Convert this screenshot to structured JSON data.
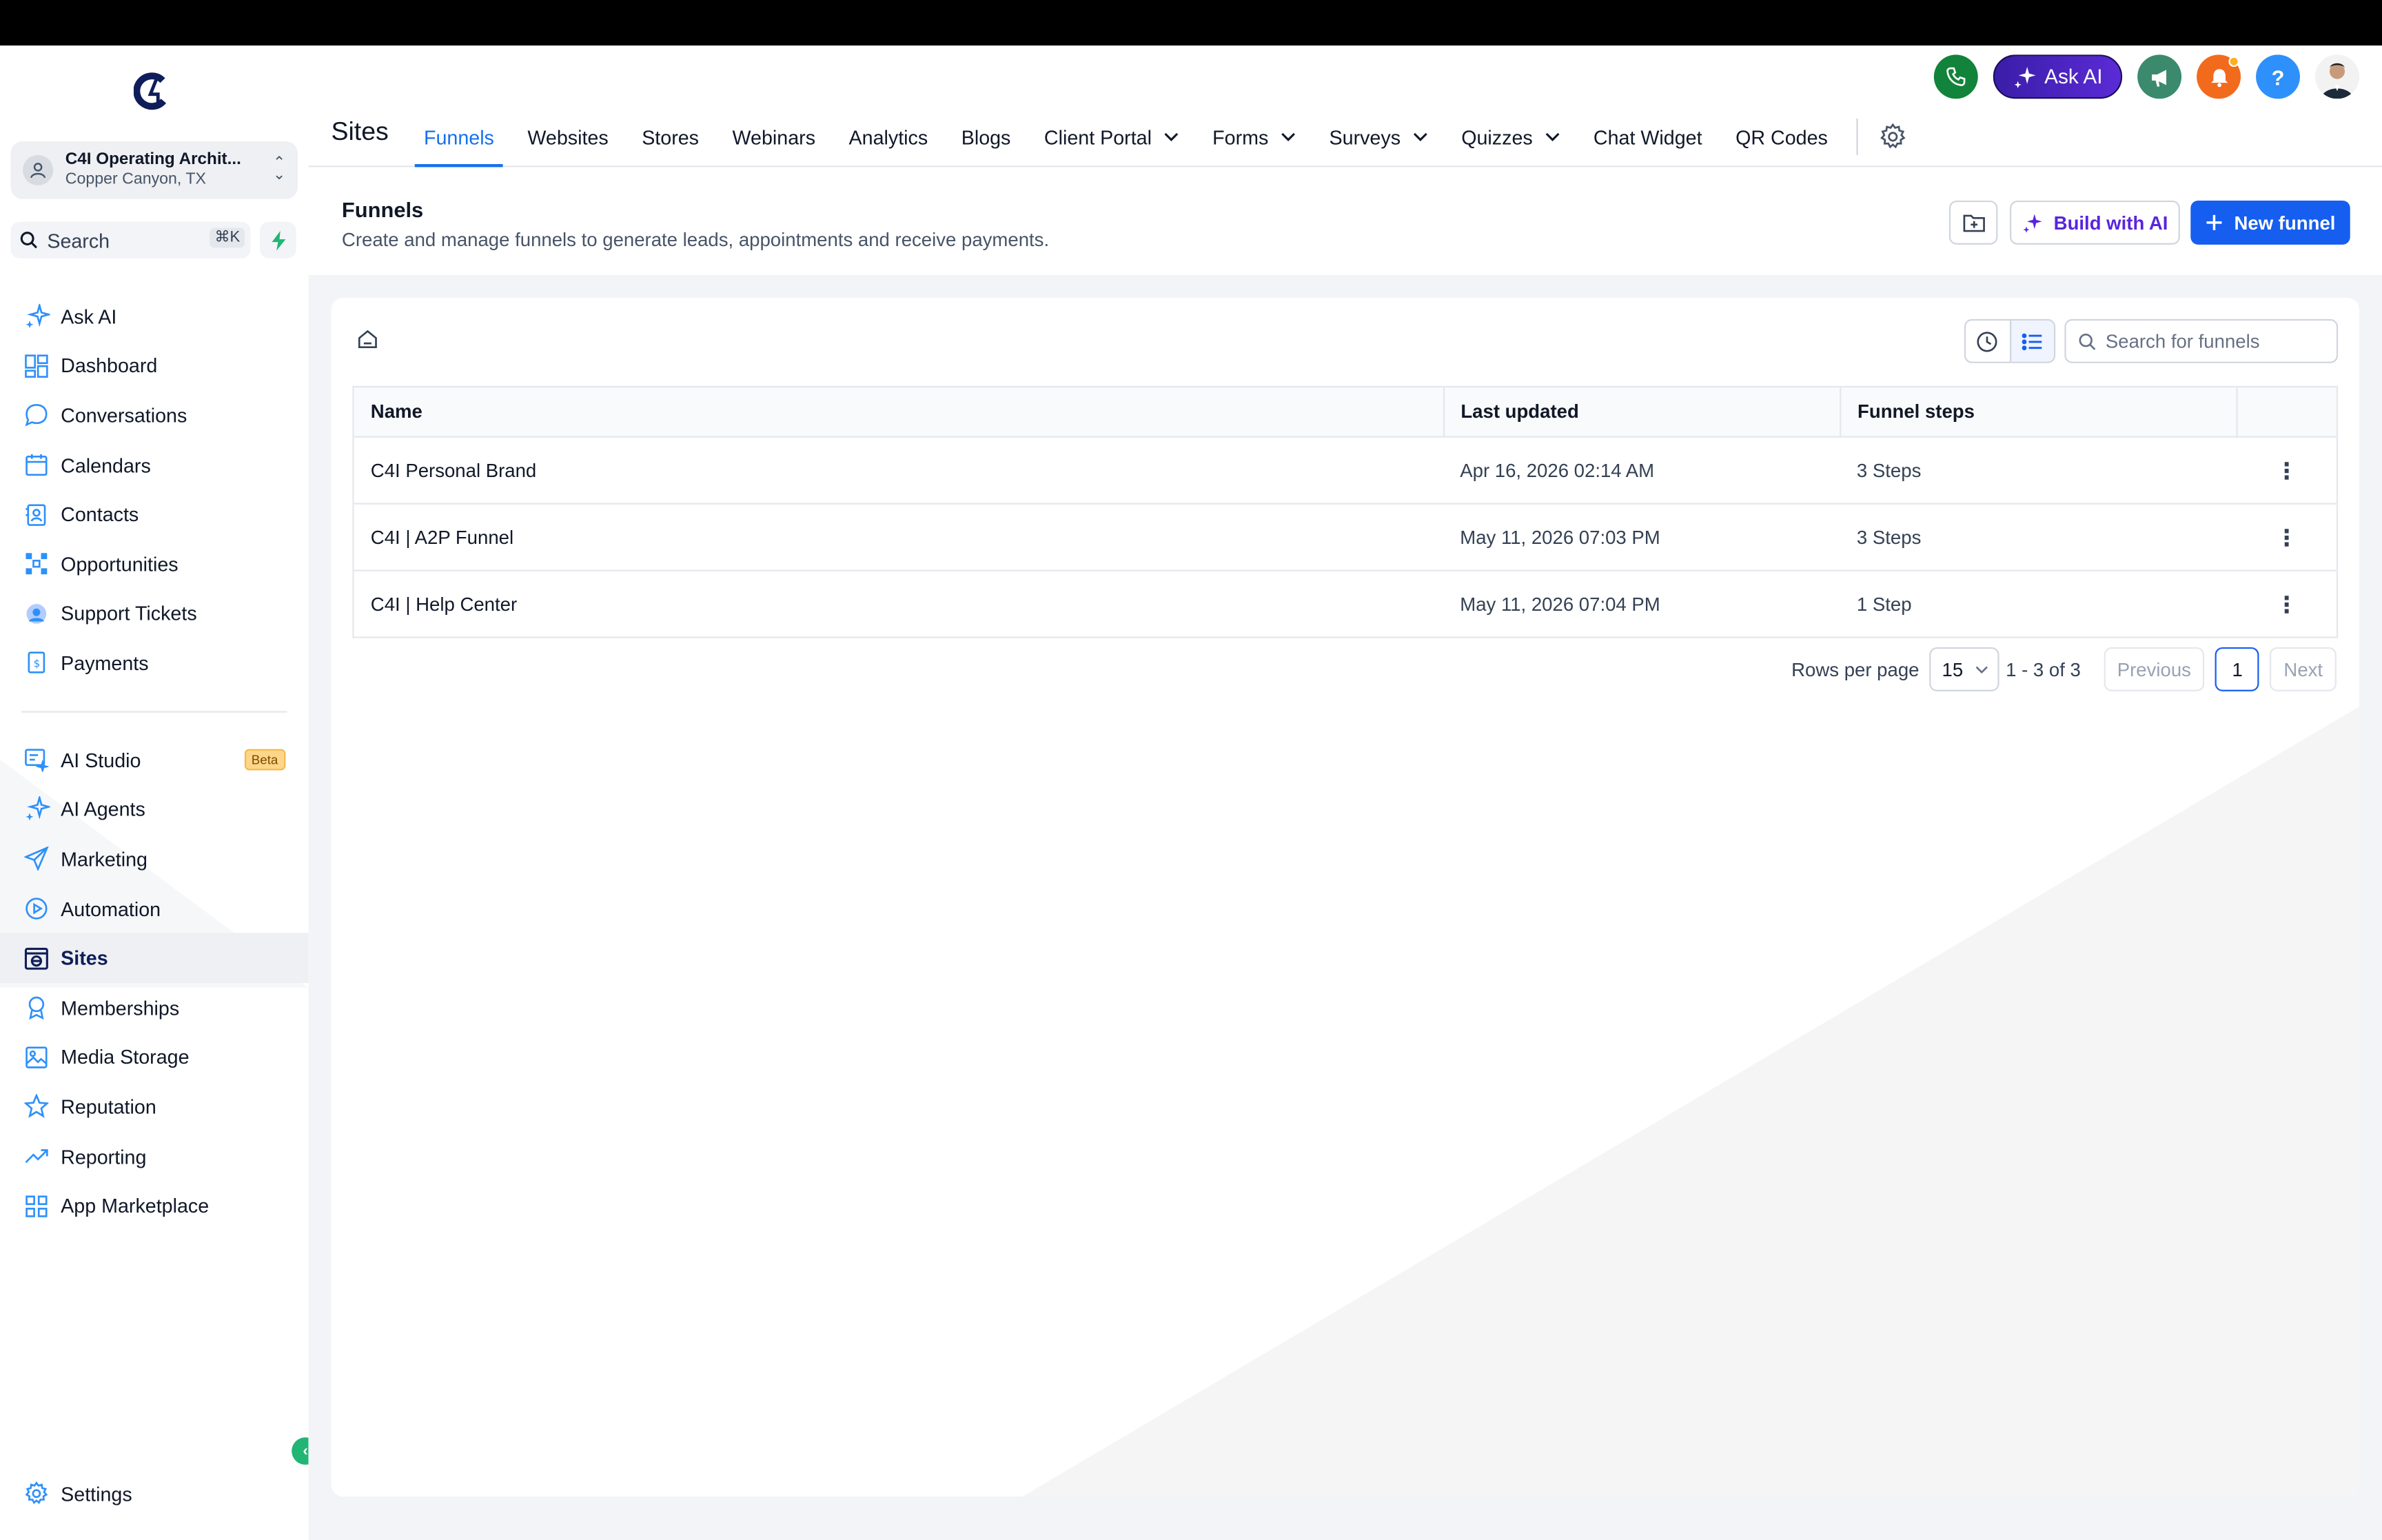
{
  "account": {
    "name": "C4I Operating Archit...",
    "location": "Copper Canyon, TX"
  },
  "sidebar": {
    "search_label": "Search",
    "search_shortcut": "⌘K",
    "items": [
      {
        "label": "Ask AI",
        "icon": "sparkle-icon"
      },
      {
        "label": "Dashboard",
        "icon": "grid-icon"
      },
      {
        "label": "Conversations",
        "icon": "chat-bubble-icon"
      },
      {
        "label": "Calendars",
        "icon": "calendar-icon"
      },
      {
        "label": "Contacts",
        "icon": "contacts-icon"
      },
      {
        "label": "Opportunities",
        "icon": "pipeline-icon"
      },
      {
        "label": "Support Tickets",
        "icon": "support-icon"
      },
      {
        "label": "Payments",
        "icon": "invoice-icon"
      }
    ],
    "items2": [
      {
        "label": "AI Studio",
        "icon": "ai-studio-icon",
        "badge": "Beta"
      },
      {
        "label": "AI Agents",
        "icon": "sparkle-icon"
      },
      {
        "label": "Marketing",
        "icon": "send-icon"
      },
      {
        "label": "Automation",
        "icon": "play-circle-icon"
      },
      {
        "label": "Sites",
        "icon": "globe-window-icon"
      },
      {
        "label": "Memberships",
        "icon": "award-icon"
      },
      {
        "label": "Media Storage",
        "icon": "image-icon"
      },
      {
        "label": "Reputation",
        "icon": "star-icon"
      },
      {
        "label": "Reporting",
        "icon": "trend-icon"
      },
      {
        "label": "App Marketplace",
        "icon": "apps-icon"
      }
    ],
    "active": "Sites",
    "settings_label": "Settings"
  },
  "header": {
    "title": "Sites",
    "tabs": [
      {
        "label": "Funnels",
        "active": true
      },
      {
        "label": "Websites"
      },
      {
        "label": "Stores"
      },
      {
        "label": "Webinars"
      },
      {
        "label": "Analytics"
      },
      {
        "label": "Blogs"
      },
      {
        "label": "Client Portal",
        "dropdown": true
      },
      {
        "label": "Forms",
        "dropdown": true
      },
      {
        "label": "Surveys",
        "dropdown": true
      },
      {
        "label": "Quizzes",
        "dropdown": true
      },
      {
        "label": "Chat Widget"
      },
      {
        "label": "QR Codes"
      }
    ],
    "ask_ai_label": "Ask AI",
    "help_label": "?"
  },
  "main": {
    "heading": "Funnels",
    "subheading": "Create and manage funnels to generate leads, appointments and receive payments.",
    "build_ai_label": "Build with AI",
    "new_funnel_label": "New funnel",
    "search_placeholder": "Search for funnels",
    "table": {
      "headers": [
        "Name",
        "Last updated",
        "Funnel steps",
        ""
      ],
      "rows": [
        {
          "name": "C4I Personal Brand",
          "updated": "Apr 16, 2026 02:14 AM",
          "steps": "3 Steps"
        },
        {
          "name": "C4I | A2P Funnel",
          "updated": "May 11, 2026 07:03 PM",
          "steps": "3 Steps"
        },
        {
          "name": "C4I | Help Center",
          "updated": "May 11, 2026 07:04 PM",
          "steps": "1 Step"
        }
      ]
    },
    "pagination": {
      "rows_per_page_label": "Rows per page",
      "rows_per_page": "15",
      "range": "1 - 3 of 3",
      "previous": "Previous",
      "current_page": "1",
      "next": "Next"
    }
  },
  "colors": {
    "accent": "#155eef",
    "ai_purple": "#5925dc",
    "phone_green": "#12833a",
    "bell_orange": "#f26b1d",
    "help_blue": "#2e90fa",
    "megaphone_teal": "#3b8a6e"
  }
}
